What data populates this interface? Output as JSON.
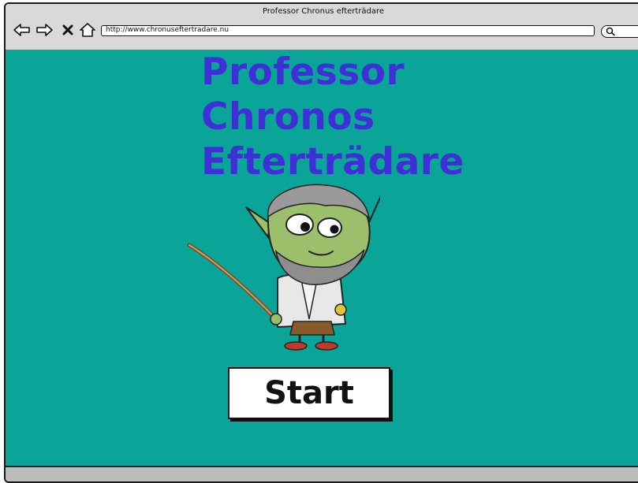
{
  "window": {
    "title": "Professor Chronus efterträdare",
    "url": "http://www.chronuseftertradare.nu"
  },
  "nav_icons": [
    "back-arrow-icon",
    "forward-arrow-icon",
    "close-icon",
    "home-icon"
  ],
  "main": {
    "title_lines": [
      "Professor",
      "Chronos",
      "Efterträdare"
    ],
    "start_label": "Start",
    "mascot": "goblin-professor-illustration"
  },
  "colors": {
    "background": "#0aa598",
    "title": "#3f2fd7",
    "chrome": "#d9d9d9"
  }
}
